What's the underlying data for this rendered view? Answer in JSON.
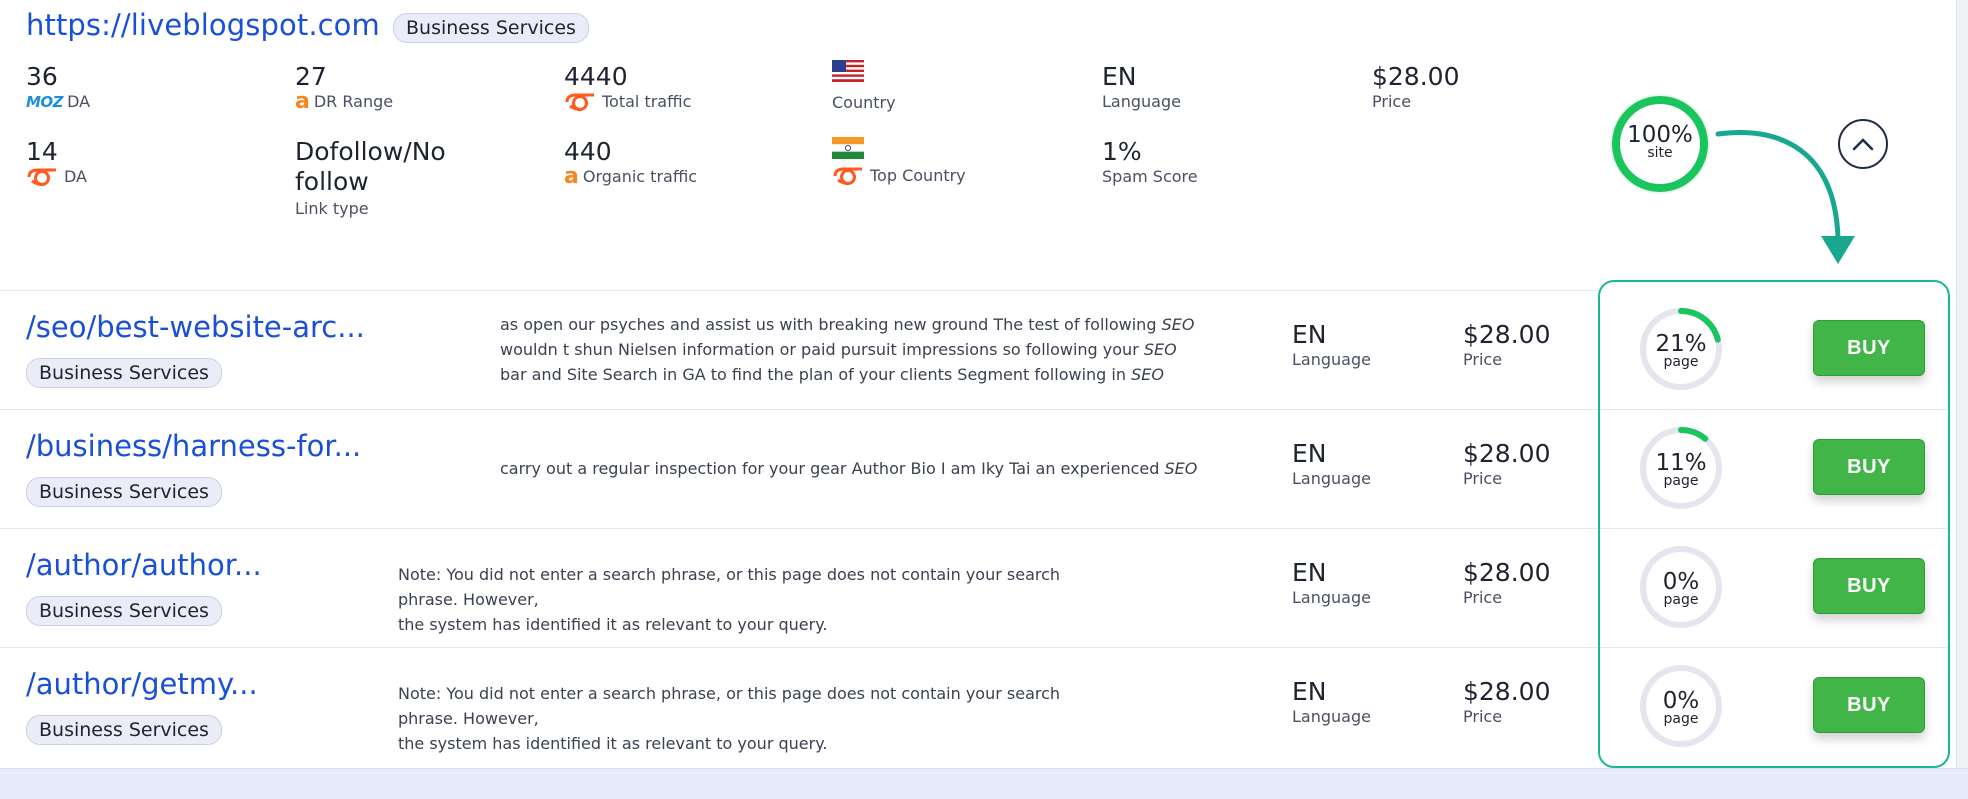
{
  "site": {
    "url": "https://liveblogspot.com",
    "category": "Business Services",
    "metrics": {
      "moz_da": {
        "value": "36",
        "brand": "MOZ",
        "label": "DA"
      },
      "dr_range": {
        "value": "27",
        "label": "DR Range"
      },
      "total_traffic": {
        "value": "4440",
        "label": "Total traffic"
      },
      "country": {
        "label": "Country",
        "flag": "us-flag-icon"
      },
      "language": {
        "value": "EN",
        "label": "Language"
      },
      "price": {
        "value": "$28.00",
        "label": "Price"
      },
      "semrush_da": {
        "value": "14",
        "label": "DA"
      },
      "link_type": {
        "value_line1": "Dofollow/No",
        "value_line2": "follow",
        "label": "Link type"
      },
      "organic_traffic": {
        "value": "440",
        "label": "Organic traffic"
      },
      "top_country": {
        "label": "Top Country",
        "flag": "india-flag-icon"
      },
      "spam_score": {
        "value": "1%",
        "label": "Spam Score"
      }
    },
    "site_score": {
      "percent": 100,
      "text": "100%",
      "sub": "site"
    }
  },
  "colors": {
    "link": "#1a4fd8",
    "accent": "#19b894",
    "buy": "#42b549",
    "ring_track": "#e4e5ee"
  },
  "rows": [
    {
      "path": "/seo/best-website-arc...",
      "category": "Business Services",
      "desc_lines": [
        [
          "as open our psyches and assist us with breaking new ground The test of following ",
          "SEO"
        ],
        [
          "wouldn t shun Nielsen information or paid pursuit impressions so following your ",
          "SEO"
        ],
        [
          "bar and Site Search in GA to find the plan of your clients Segment following in ",
          "SEO"
        ]
      ],
      "language": "EN",
      "language_label": "Language",
      "price": "$28.00",
      "price_label": "Price",
      "page_percent": 21,
      "page_text": "21%",
      "page_sub": "page",
      "buy_label": "BUY"
    },
    {
      "path": "/business/harness-for...",
      "category": "Business Services",
      "desc_lines": [
        [
          "carry out a regular inspection for your gear Author Bio I am Iky Tai an experienced ",
          "SEO"
        ]
      ],
      "language": "EN",
      "language_label": "Language",
      "price": "$28.00",
      "price_label": "Price",
      "page_percent": 11,
      "page_text": "11%",
      "page_sub": "page",
      "buy_label": "BUY"
    },
    {
      "path": "/author/author...",
      "category": "Business Services",
      "desc_lines": [
        [
          "Note: You did not enter a search phrase, or this page does not contain your search phrase. However,",
          ""
        ],
        [
          "the system has identified it as relevant to your query.",
          ""
        ]
      ],
      "language": "EN",
      "language_label": "Language",
      "price": "$28.00",
      "price_label": "Price",
      "page_percent": 0,
      "page_text": "0%",
      "page_sub": "page",
      "buy_label": "BUY"
    },
    {
      "path": "/author/getmy...",
      "category": "Business Services",
      "desc_lines": [
        [
          "Note: You did not enter a search phrase, or this page does not contain your search phrase. However,",
          ""
        ],
        [
          "the system has identified it as relevant to your query.",
          ""
        ]
      ],
      "language": "EN",
      "language_label": "Language",
      "price": "$28.00",
      "price_label": "Price",
      "page_percent": 0,
      "page_text": "0%",
      "page_sub": "page",
      "buy_label": "BUY"
    }
  ]
}
